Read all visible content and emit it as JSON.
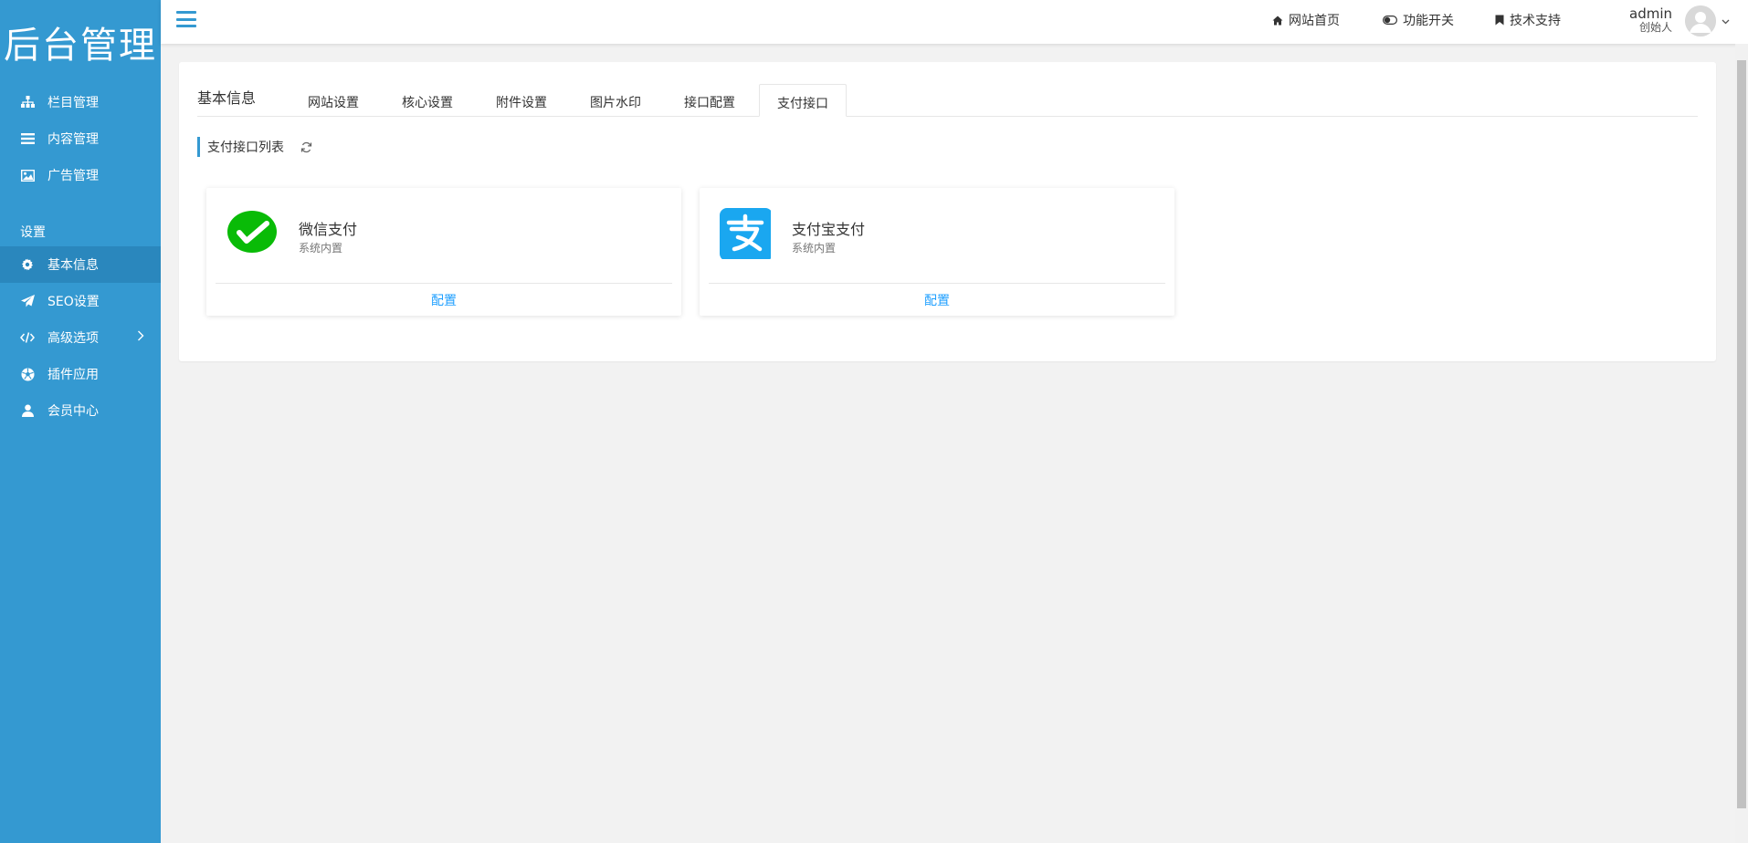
{
  "sidebar": {
    "logo": "后台管理",
    "items": [
      {
        "label": "栏目管理",
        "icon": "sitemap-icon"
      },
      {
        "label": "内容管理",
        "icon": "list-icon"
      },
      {
        "label": "广告管理",
        "icon": "image-icon"
      }
    ],
    "section_label": "设置",
    "settings_items": [
      {
        "label": "基本信息",
        "icon": "gear-icon",
        "active": true
      },
      {
        "label": "SEO设置",
        "icon": "paper-plane-icon"
      },
      {
        "label": "高级选项",
        "icon": "code-icon",
        "has_submenu": true
      },
      {
        "label": "插件应用",
        "icon": "soccer-ball-icon"
      },
      {
        "label": "会员中心",
        "icon": "user-icon"
      }
    ]
  },
  "topbar": {
    "links": [
      {
        "label": "网站首页",
        "icon": "home-icon"
      },
      {
        "label": "功能开关",
        "icon": "toggle-icon"
      },
      {
        "label": "技术支持",
        "icon": "bookmark-icon"
      }
    ],
    "user": {
      "name": "admin",
      "role": "创始人"
    }
  },
  "panel": {
    "title": "基本信息",
    "tabs": [
      "网站设置",
      "核心设置",
      "附件设置",
      "图片水印",
      "接口配置",
      "支付接口"
    ],
    "active_tab": "支付接口",
    "section_title": "支付接口列表",
    "cards": [
      {
        "name": "微信支付",
        "desc": "系统内置",
        "action": "配置",
        "icon": "wechat-pay-icon",
        "color": "#09bb07"
      },
      {
        "name": "支付宝支付",
        "desc": "系统内置",
        "action": "配置",
        "icon": "alipay-icon",
        "color": "#1aa7f0"
      }
    ]
  },
  "colors": {
    "sidebar": "#3499d1",
    "sidebar_active": "#2a87bd",
    "link": "#1e9fff"
  }
}
